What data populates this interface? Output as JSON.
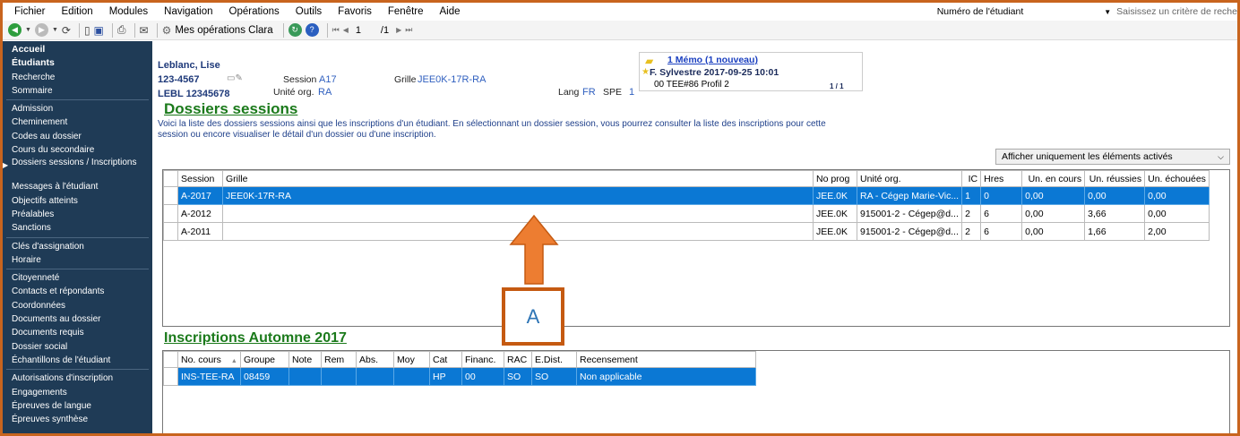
{
  "menu": [
    "Fichier",
    "Edition",
    "Modules",
    "Navigation",
    "Opérations",
    "Outils",
    "Favoris",
    "Fenêtre",
    "Aide"
  ],
  "search": {
    "label": "Numéro de l'étudiant",
    "placeholder": "Saisissez un critère de reche"
  },
  "toolbar": {
    "my_operations": "Mes opérations Clara",
    "page_current": "1",
    "page_total": "/1"
  },
  "sidebar": {
    "items": [
      "Accueil",
      "Étudiants",
      "Recherche",
      "Sommaire",
      "Admission",
      "Cheminement",
      "Codes au dossier",
      "Cours du secondaire",
      "Dossiers sessions / Inscriptions",
      "Messages à l'étudiant",
      "Objectifs atteints",
      "Préalables",
      "Sanctions",
      "Clés d'assignation",
      "Horaire",
      "Citoyenneté",
      "Contacts et répondants",
      "Coordonnées",
      "Documents au dossier",
      "Documents requis",
      "Dossier social",
      "Échantillons de l'étudiant",
      "Autorisations d'inscription",
      "Engagements",
      "Épreuves de langue",
      "Épreuves synthèse"
    ]
  },
  "student": {
    "name": "Leblanc, Lise",
    "id": "123-4567",
    "code": "LEBL 12345678",
    "session_label": "Session",
    "session": "A17",
    "unit_label": "Unité org.",
    "unit": "RA",
    "grid_label": "Grille",
    "grid": "JEE0K-17R-RA",
    "lang_label": "Lang",
    "lang": "FR",
    "spe_label": "SPE",
    "spe": "1"
  },
  "memo": {
    "title": "1 Mémo (1 nouveau)",
    "author": "F. Sylvestre 2017-09-25 10:01",
    "detail": "00 TEE#86 Profil 2",
    "pager": "1 / 1"
  },
  "dossiers": {
    "title": "Dossiers sessions",
    "description": "Voici la liste des dossiers sessions ainsi que les inscriptions d'un étudiant. En sélectionnant un dossier session, vous pourrez consulter la liste des inscriptions pour cette session ou encore visualiser le détail d'un dossier ou d'une inscription.",
    "filter": "Afficher uniquement les éléments activés",
    "columns": [
      "",
      "Session",
      "Grille",
      "No prog",
      "Unité org.",
      "IC",
      "Hres",
      "Un. en cours",
      "Un. réussies",
      "Un. échouées"
    ],
    "rows": [
      [
        "A-2017",
        "JEE0K-17R-RA",
        "JEE.0K",
        "RA - Cégep Marie-Vic...",
        "1",
        "0",
        "0,00",
        "0,00",
        "0,00"
      ],
      [
        "A-2012",
        "",
        "JEE.0K",
        "915001-2 - Cégep@d...",
        "2",
        "6",
        "0,00",
        "3,66",
        "0,00"
      ],
      [
        "A-2011",
        "",
        "JEE.0K",
        "915001-2 - Cégep@d...",
        "2",
        "6",
        "0,00",
        "1,66",
        "2,00"
      ]
    ]
  },
  "inscriptions": {
    "title": "Inscriptions Automne 2017",
    "columns": [
      "",
      "No. cours",
      "Groupe",
      "Note",
      "Rem",
      "Abs.",
      "Moy",
      "Cat",
      "Financ.",
      "RAC",
      "E.Dist.",
      "Recensement"
    ],
    "rows": [
      [
        "INS-TEE-RA",
        "08459",
        "",
        "",
        "",
        "",
        "HP",
        "00",
        "SO",
        "SO",
        "Non applicable"
      ]
    ]
  },
  "annotation": {
    "label": "A",
    "color": "#ed7d31"
  }
}
